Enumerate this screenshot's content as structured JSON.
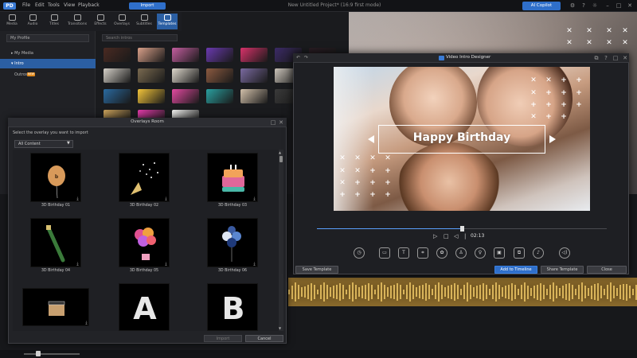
{
  "menu": {
    "items": [
      "File",
      "Edit",
      "Tools",
      "View",
      "Playback"
    ],
    "project_title": "New Untitled Project* (16:9 first mode)",
    "upgrade_label": "AI Copilot",
    "logo": "PD"
  },
  "tabs": {
    "items": [
      "Media",
      "Audio",
      "Titles",
      "Transitions",
      "Effects",
      "Overlays",
      "Subtitles",
      "Templates"
    ],
    "import_label": "Import"
  },
  "library": {
    "profile_value": "My Profile",
    "tree": [
      "My Media",
      "Intro",
      "Outros"
    ],
    "new_badge": "NEW",
    "search_placeholder": "Search intros",
    "thumb_colors": [
      "#4a2a22",
      "#d9a089",
      "#c45ea0",
      "#6a3ab0",
      "#d8326a",
      "#3b2a66",
      "#2a1d24",
      "#d5d0c8",
      "#7a6a50",
      "#ded8cc",
      "#8c5a40",
      "#7a6aa0",
      "#c9c2b8",
      "#b7472a",
      "#2a6aa0",
      "#f3c43a",
      "#e34aa0",
      "#2aa0a0",
      "#d2c0aa",
      "#3a3a3a",
      "#e05a1a",
      "#c8a05a",
      "#e03aa8",
      "#f0f0ee"
    ]
  },
  "overlays_room": {
    "title": "Overlays Room",
    "prompt": "Select the overlay you want to import",
    "filter_value": "All Content",
    "items": [
      {
        "label": "3D Birthday 01"
      },
      {
        "label": "3D Birthday 02"
      },
      {
        "label": "3D Birthday 03"
      },
      {
        "label": "3D Birthday 04"
      },
      {
        "label": "3D Birthday 05"
      },
      {
        "label": "3D Birthday 06"
      },
      {
        "label": ""
      },
      {
        "label": "",
        "glyph": "A"
      },
      {
        "label": "",
        "glyph": "B"
      }
    ],
    "import_label": "Import",
    "cancel_label": "Cancel"
  },
  "video_intro_designer": {
    "title": "Video Intro Designer",
    "title_text": "Happy Birthday",
    "time": "02:13",
    "progress": 0.5,
    "buttons": {
      "save_template": "Save Template",
      "add_to_timeline": "Add to Timeline",
      "share_template": "Share Template",
      "close": "Close"
    },
    "tools": [
      "clock-icon",
      "scene-icon",
      "text-icon",
      "crop-icon",
      "sticker-icon",
      "effect-icon",
      "narration-icon",
      "image-icon",
      "overlay-icon",
      "music-icon",
      "volume-icon"
    ]
  },
  "colors": {
    "accent": "#2f6fca",
    "active_tab": "#2b5fa3",
    "audio_track": "#8a6a2c"
  }
}
